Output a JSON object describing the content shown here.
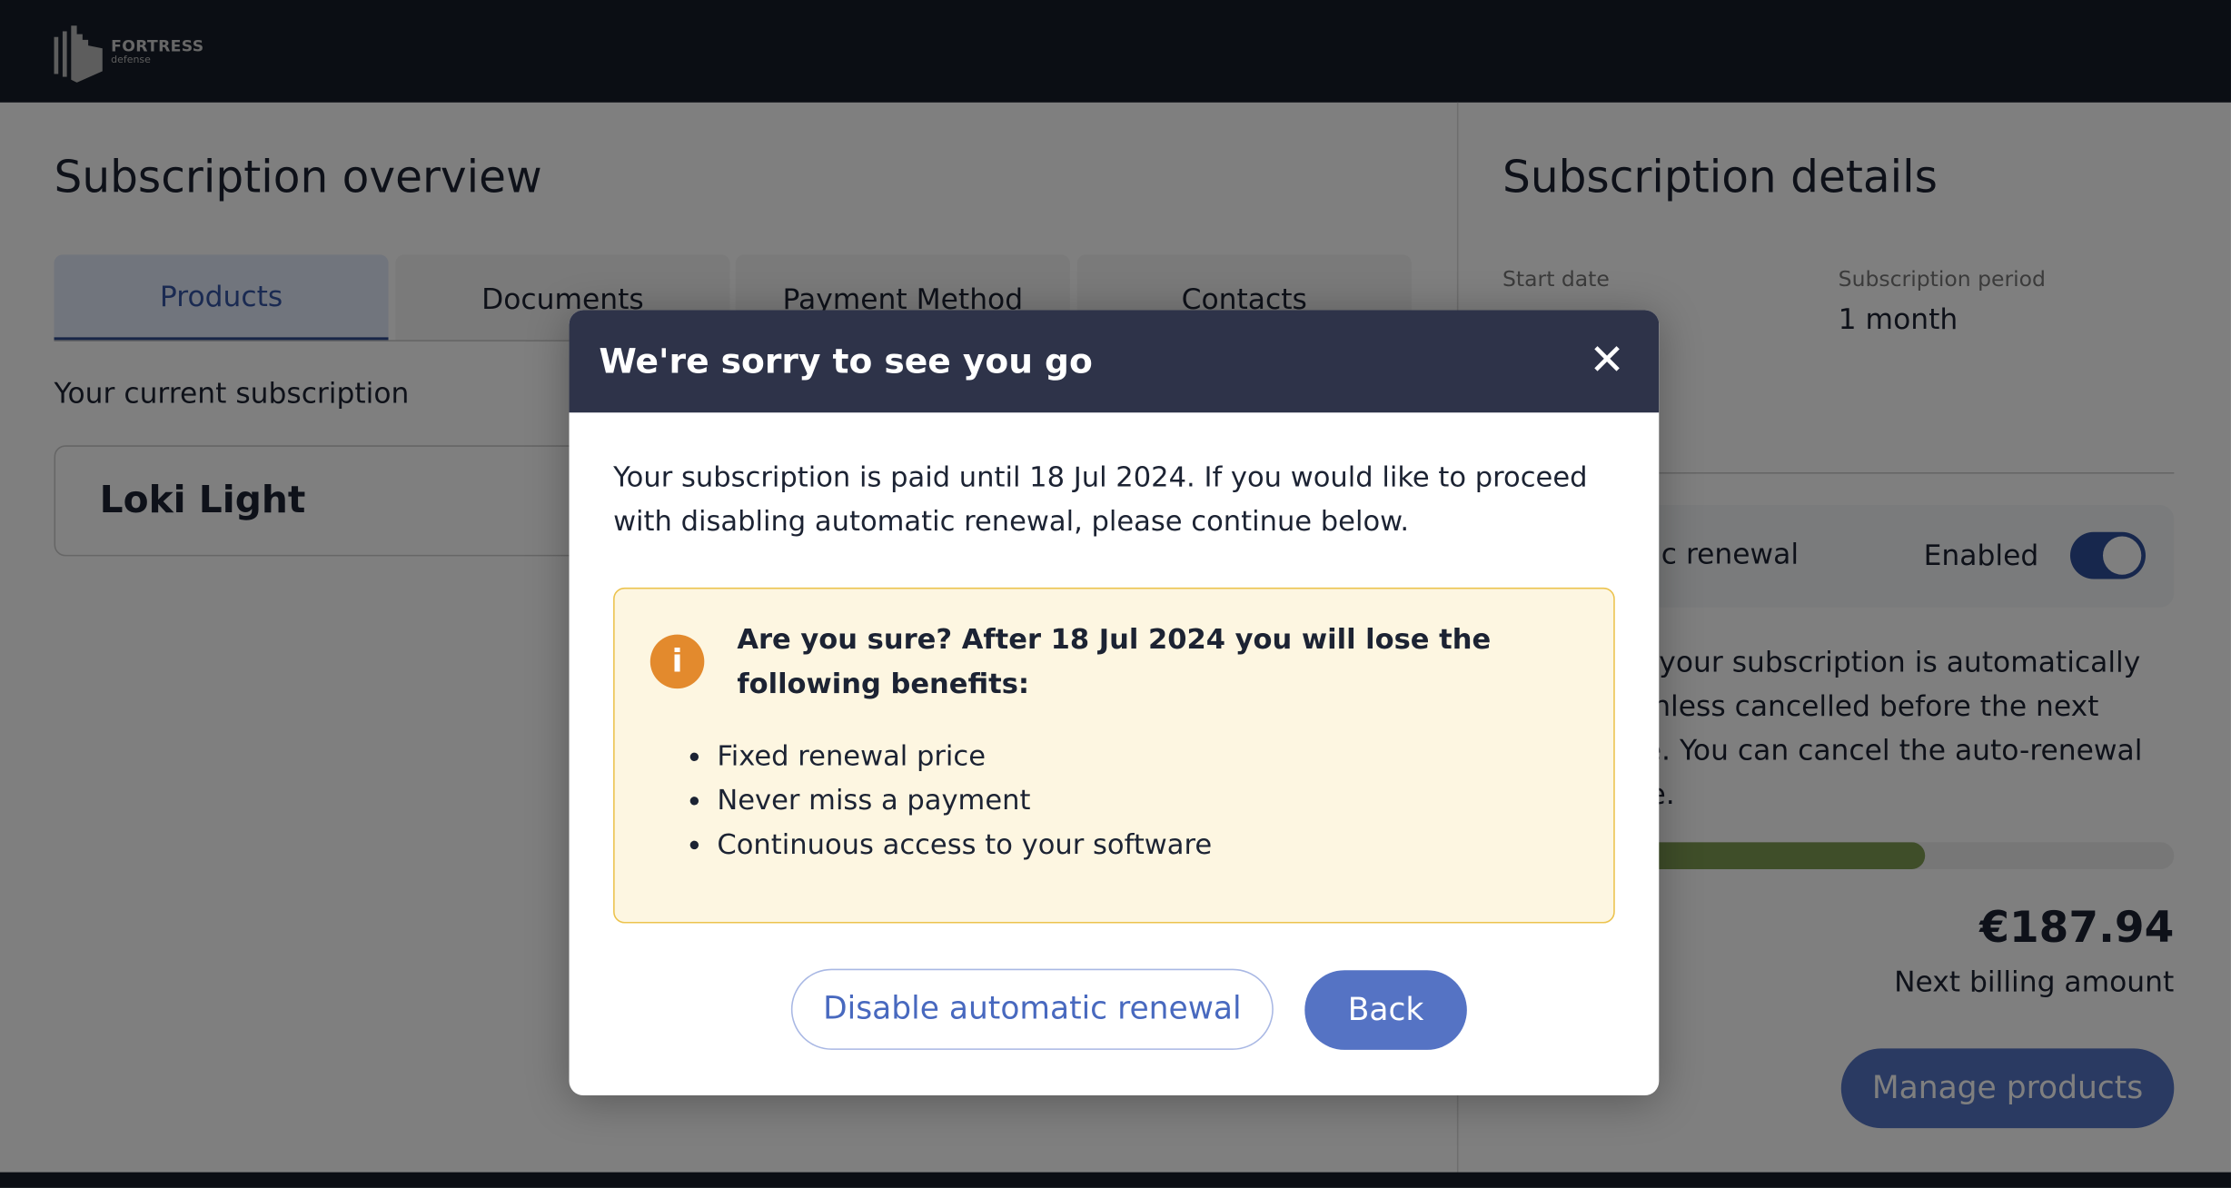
{
  "header": {
    "logo_text": "FORTRESS",
    "logo_sub": "defense"
  },
  "overview": {
    "title": "Subscription overview",
    "tabs": [
      {
        "label": "Products",
        "active": true
      },
      {
        "label": "Documents"
      },
      {
        "label": "Payment Method"
      },
      {
        "label": "Contacts"
      }
    ],
    "section_label": "Your current subscription",
    "product_name": "Loki Light"
  },
  "details": {
    "title": "Subscription details",
    "start_date_label": "Start date",
    "period_label": "Subscription period",
    "period_value": "1 month",
    "renewal_label": "Automatic renewal",
    "renewal_status": "Enabled",
    "renewal_enabled": true,
    "renewal_text": "your subscription is automatically renewed unless cancelled before the next billing date. You can cancel the auto-renewal at any time.",
    "progress_percent": 63,
    "amount": "€187.94",
    "amount_label": "Next billing amount",
    "manage_button": "Manage products"
  },
  "modal": {
    "title": "We're sorry to see you go",
    "close_icon": "close-icon",
    "message": "Your subscription is paid until 18 Jul 2024. If you would like to proceed with disabling automatic renewal, please continue below.",
    "warning_title": "Are you sure? After 18 Jul 2024 you will lose the following benefits:",
    "benefits": [
      "Fixed renewal price",
      "Never miss a payment",
      "Continuous access to your software"
    ],
    "disable_button": "Disable automatic renewal",
    "back_button": "Back"
  },
  "colors": {
    "header": "#171c28",
    "modal_header": "#2e3349",
    "primary": "#5573c4",
    "warning_bg": "#fdf6e1",
    "warning_border": "#ecc34e",
    "warning_icon": "#e38a2d"
  }
}
